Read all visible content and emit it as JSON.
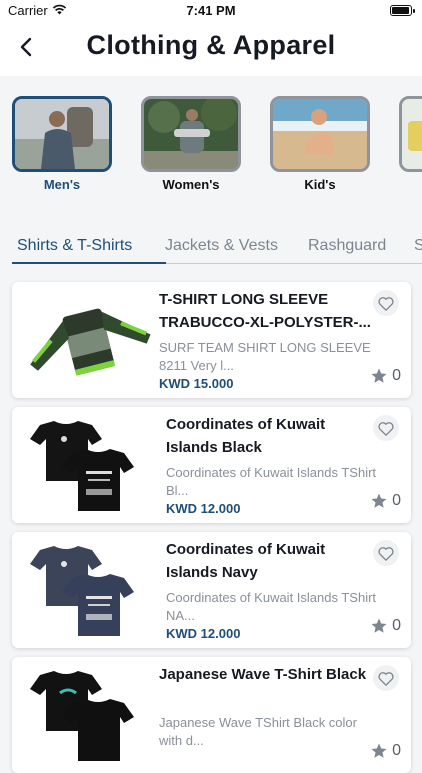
{
  "status_bar": {
    "carrier": "Carrier",
    "time": "7:41 PM"
  },
  "header": {
    "title": "Clothing & Apparel",
    "back_icon": "chevron-left-icon"
  },
  "categories": [
    {
      "label": "Men's",
      "active": true
    },
    {
      "label": "Women's",
      "active": false
    },
    {
      "label": "Kid's",
      "active": false
    },
    {
      "label": "",
      "active": false
    }
  ],
  "tabs": [
    {
      "label": "Shirts & T-Shirts",
      "active": true
    },
    {
      "label": "Jackets & Vests",
      "active": false
    },
    {
      "label": "Rashguard",
      "active": false
    },
    {
      "label": "S",
      "active": false
    }
  ],
  "products": [
    {
      "name": "T-SHIRT LONG SLEEVE TRABUCCO-XL-POLYSTER-...",
      "description": "SURF TEAM SHIRT LONG SLEEVE 8211 Very l...",
      "price": "KWD 15.000",
      "rating_count": "0"
    },
    {
      "name": "Coordinates of Kuwait Islands Black",
      "description": "Coordinates of Kuwait Islands TShirt Bl...",
      "price": "KWD 12.000",
      "rating_count": "0"
    },
    {
      "name": "Coordinates of Kuwait Islands Navy",
      "description": "Coordinates of Kuwait Islands TShirt NA...",
      "price": "KWD 12.000",
      "rating_count": "0"
    },
    {
      "name": "Japanese Wave T-Shirt Black",
      "description": "Japanese Wave TShirt Black color with d...",
      "price": "",
      "rating_count": "0"
    }
  ],
  "colors": {
    "accent": "#1f4e79",
    "muted": "#8a9099"
  }
}
